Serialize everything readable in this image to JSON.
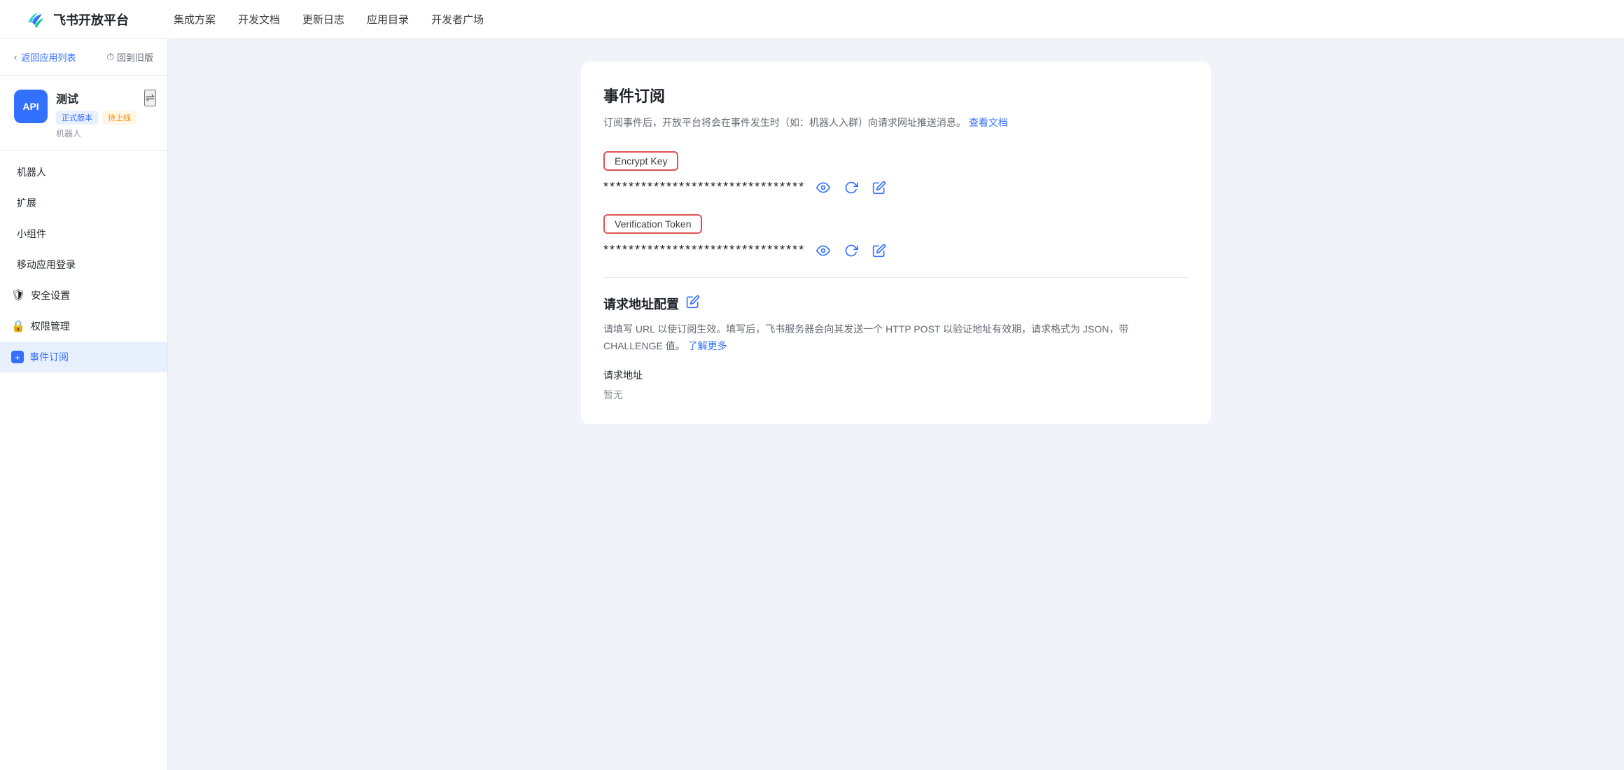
{
  "topnav": {
    "logo_text": "飞书开放平台",
    "links": [
      "集成方案",
      "开发文档",
      "更新日志",
      "应用目录",
      "开发者广场"
    ]
  },
  "sidebar": {
    "back_label": "返回应用列表",
    "history_label": "回到旧版",
    "app_icon_text": "API",
    "app_name": "测试",
    "badge_official": "正式版本",
    "badge_pending": "待上线",
    "app_type": "机器人",
    "nav_items": [
      {
        "id": "robot",
        "label": "机器人",
        "icon": "",
        "active": false
      },
      {
        "id": "extension",
        "label": "扩展",
        "icon": "",
        "active": false
      },
      {
        "id": "widget",
        "label": "小组件",
        "icon": "",
        "active": false
      },
      {
        "id": "mobile-login",
        "label": "移动应用登录",
        "icon": "",
        "active": false
      },
      {
        "id": "security",
        "label": "安全设置",
        "icon": "🛡",
        "active": false
      },
      {
        "id": "permissions",
        "label": "权限管理",
        "icon": "🔒",
        "active": false
      },
      {
        "id": "event-sub",
        "label": "事件订阅",
        "icon": "+",
        "active": true
      }
    ]
  },
  "main": {
    "section_title": "事件订阅",
    "section_desc": "订阅事件后，开放平台将会在事件发生时（如：机器人入群）向请求网址推送消息。",
    "section_link_text": "查看文档",
    "encrypt_key_label": "Encrypt Key",
    "encrypt_key_masked": "********************************",
    "verification_token_label": "Verification Token",
    "verification_token_masked": "********************************",
    "request_url_section_title": "请求地址配置",
    "request_url_desc": "请填写 URL 以使订阅生效。填写后，飞书服务器会向其发送一个 HTTP POST 以验证地址有效期，请求格式为 JSON，带 CHALLENGE 值。",
    "request_url_learn_more": "了解更多",
    "request_url_label": "请求地址",
    "request_url_value": "暂无",
    "colors": {
      "accent": "#3370ff",
      "highlight_border": "#e05252",
      "active_bg": "#e8f0fe"
    }
  }
}
